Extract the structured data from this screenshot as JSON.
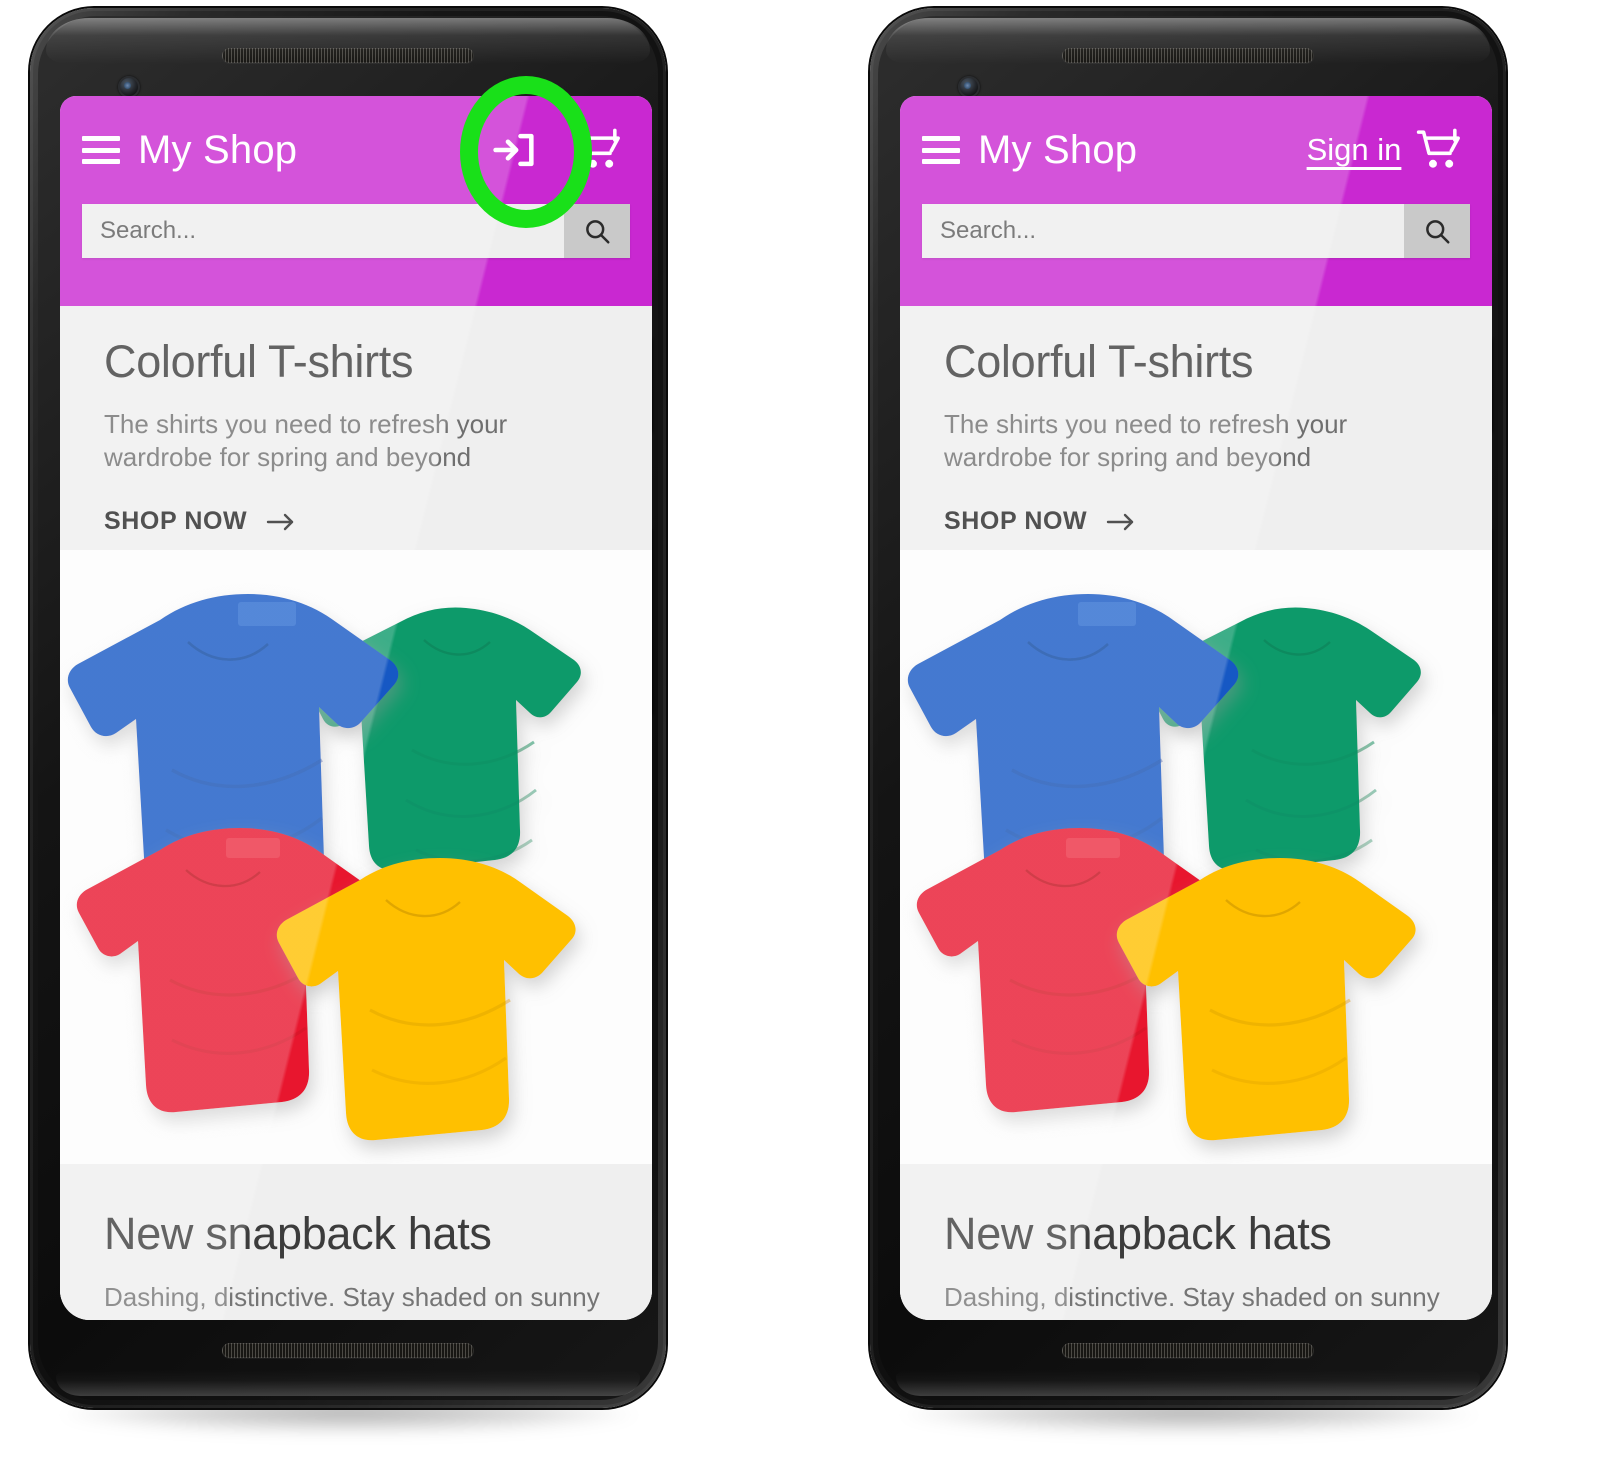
{
  "app": {
    "title": "My Shop",
    "brand_color": "#c928d1",
    "accent_highlight_color": "#19e019",
    "content_bg": "#efefef"
  },
  "search": {
    "placeholder": "Search...",
    "value": "",
    "button_icon": "search-icon"
  },
  "header": {
    "menu_icon": "hamburger-menu-icon",
    "cart_icon": "shopping-cart-icon"
  },
  "promo": {
    "title": "Colorful T-shirts",
    "subtitle": "The shirts you need to refresh your wardrobe for spring and beyond",
    "cta_label": "SHOP NOW",
    "cta_icon": "arrow-right-icon",
    "image_alt": "four folded t-shirts",
    "shirt_colors": [
      "#1559c4",
      "#0f9a6a",
      "#e8182f",
      "#ffc000"
    ]
  },
  "promo2": {
    "title": "New snapback hats",
    "subtitle": "Dashing, distinctive. Stay shaded on sunny"
  },
  "variants": [
    {
      "id": "left",
      "auth_control": "login-arrow-icon",
      "auth_label": "",
      "highlight": "login-icon-highlight"
    },
    {
      "id": "right",
      "auth_control": "sign-in-link",
      "auth_label": "Sign in",
      "highlight": "sign-in-link-highlight"
    }
  ]
}
